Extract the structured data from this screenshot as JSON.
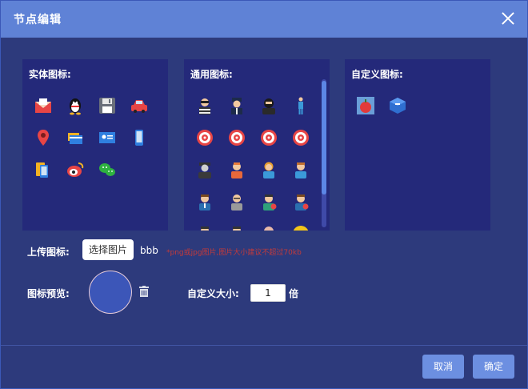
{
  "dialog": {
    "title": "节点编辑"
  },
  "panels": {
    "entity": {
      "title": "实体图标:",
      "icons": [
        [
          "envelope-icon",
          "qq-penguin-icon",
          "floppy-disk-icon",
          "car-icon"
        ],
        [
          "location-pin-icon",
          "bank-card-icon",
          "id-card-icon",
          "mobile-phone-icon"
        ],
        [
          "devices-icon",
          "weibo-icon",
          "wechat-icon"
        ]
      ]
    },
    "common": {
      "title": "通用图标:",
      "icons": [
        [
          "thief-icon",
          "police-officer-icon",
          "masked-person-icon",
          "standing-person-icon"
        ],
        [
          "target-icon",
          "target-icon",
          "target-icon",
          "target-icon"
        ],
        [
          "spy-icon",
          "male-user-icon",
          "female-user-icon",
          "boy-user-icon"
        ],
        [
          "man-suit-icon",
          "man-glasses-icon",
          "woman-badge-1-icon",
          "man-badge-2-icon"
        ],
        [
          "woman-badge-3-icon",
          "woman-badge-4-icon",
          "bald-person-icon",
          "smiley-face-icon"
        ]
      ]
    },
    "custom": {
      "title": "自定义图标:",
      "icons": [
        [
          "red-apple-icon",
          "blue-cube-icon"
        ]
      ]
    }
  },
  "upload": {
    "label": "上传图标:",
    "button": "选择图片",
    "filename": "bbb",
    "hint": "*png或jpg图片,图片大小建议不超过70kb"
  },
  "preview": {
    "label": "图标预览:"
  },
  "size": {
    "label": "自定义大小:",
    "value": "1",
    "unit": "倍"
  },
  "footer": {
    "cancel": "取消",
    "confirm": "确定"
  },
  "colors": {
    "titlebar": "#5f82d6",
    "background": "#2d3a7c",
    "panel": "#24297a",
    "button": "#6c8fe1",
    "hint": "#c43a3a"
  }
}
